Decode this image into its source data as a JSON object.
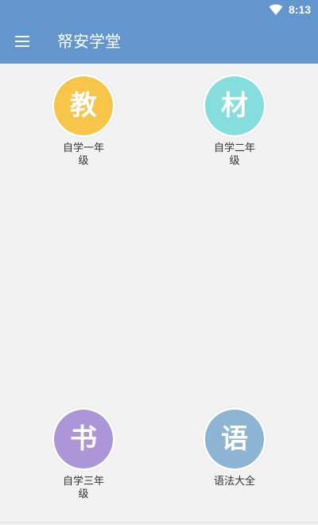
{
  "status": {
    "time": "8:13",
    "wifi_icon": "wifi-icon"
  },
  "toolbar": {
    "menu_icon": "hamburger-menu-icon",
    "title": "帑安学堂"
  },
  "tiles": [
    {
      "glyph": "教",
      "label": "自学一年级",
      "color": "#f6c54a"
    },
    {
      "glyph": "材",
      "label": "自学二年级",
      "color": "#86dddd"
    },
    {
      "glyph": "书",
      "label": "自学三年级",
      "color": "#ac96d8"
    },
    {
      "glyph": "语",
      "label": "语法大全",
      "color": "#8db4d2"
    }
  ],
  "colors": {
    "primary": "#6396cc",
    "background": "#f2f2f2"
  }
}
